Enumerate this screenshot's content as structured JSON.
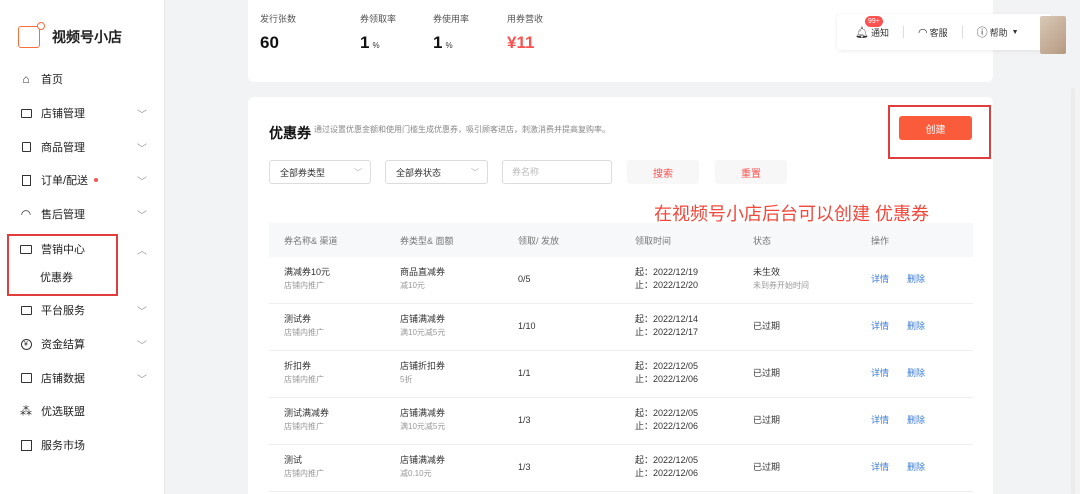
{
  "app": {
    "name": "视频号小店"
  },
  "sidebar": {
    "items": [
      {
        "label": "首页",
        "icon": "home-icon",
        "arrow": false
      },
      {
        "label": "店铺管理",
        "icon": "store-icon",
        "arrow": true
      },
      {
        "label": "商品管理",
        "icon": "bag-icon",
        "arrow": true
      },
      {
        "label": "订单/配送",
        "icon": "order-icon",
        "arrow": true,
        "dot": true
      },
      {
        "label": "售后管理",
        "icon": "headset-icon",
        "arrow": true
      },
      {
        "label": "营销中心",
        "icon": "coupon-icon",
        "arrow": true,
        "expanded": true
      },
      {
        "label": "平台服务",
        "icon": "service-icon",
        "arrow": true
      },
      {
        "label": "资金结算",
        "icon": "yuan-icon",
        "arrow": true
      },
      {
        "label": "店铺数据",
        "icon": "chart-icon",
        "arrow": true
      },
      {
        "label": "优选联盟",
        "icon": "network-icon",
        "arrow": false
      },
      {
        "label": "服务市场",
        "icon": "grid-icon",
        "arrow": false
      }
    ],
    "subitem": "优惠券"
  },
  "stats": [
    {
      "label": "发行张数",
      "value": "60",
      "unit": ""
    },
    {
      "label": "券领取率",
      "value": "1",
      "unit": "%"
    },
    {
      "label": "券使用率",
      "value": "1",
      "unit": "%"
    },
    {
      "label": "用券营收",
      "value": "¥11",
      "unit": ""
    }
  ],
  "header": {
    "notify": "通知",
    "badge": "99+",
    "service": "客服",
    "help": "帮助"
  },
  "section": {
    "title": "优惠券",
    "desc": "通过设置优惠金额和使用门槛生成优惠券，吸引顾客进店，刺激消费并提高复购率。",
    "create": "创建"
  },
  "filters": {
    "type": "全部券类型",
    "status": "全部券状态",
    "name_placeholder": "券名称",
    "search": "搜索",
    "reset": "重置"
  },
  "annotation": "在视频号小店后台可以创建 优惠券",
  "table": {
    "headers": [
      "券名称& 渠道",
      "券类型& 面额",
      "领取/ 发放",
      "领取时间",
      "状态",
      "操作"
    ],
    "rows": [
      {
        "name": "满减券10元",
        "channel": "店铺内推广",
        "type": "商品直减券",
        "amount": "减10元",
        "ratio": "0/5",
        "start": "起：2022/12/19",
        "end": "止：2022/12/20",
        "status": "未生效",
        "status_sub": "未到券开始时间",
        "detail": "详情",
        "delete": "删除"
      },
      {
        "name": "测试券",
        "channel": "店铺内推广",
        "type": "店铺满减券",
        "amount": "满10元减5元",
        "ratio": "1/10",
        "start": "起：2022/12/14",
        "end": "止：2022/12/17",
        "status": "已过期",
        "status_sub": "",
        "detail": "详情",
        "delete": "删除"
      },
      {
        "name": "折扣券",
        "channel": "店铺内推广",
        "type": "店铺折扣券",
        "amount": "5折",
        "ratio": "1/1",
        "start": "起：2022/12/05",
        "end": "止：2022/12/06",
        "status": "已过期",
        "status_sub": "",
        "detail": "详情",
        "delete": "删除"
      },
      {
        "name": "测试满减券",
        "channel": "店铺内推广",
        "type": "店铺满减券",
        "amount": "满10元减5元",
        "ratio": "1/3",
        "start": "起：2022/12/05",
        "end": "止：2022/12/06",
        "status": "已过期",
        "status_sub": "",
        "detail": "详情",
        "delete": "删除"
      },
      {
        "name": "测试",
        "channel": "店铺内推广",
        "type": "店铺满减券",
        "amount": "减0.10元",
        "ratio": "1/3",
        "start": "起：2022/12/05",
        "end": "止：2022/12/06",
        "status": "已过期",
        "status_sub": "",
        "detail": "详情",
        "delete": "删除"
      }
    ]
  },
  "colors": {
    "accent": "#fa5b3b",
    "link": "#3b7bd6",
    "annotation": "#f0483c"
  }
}
